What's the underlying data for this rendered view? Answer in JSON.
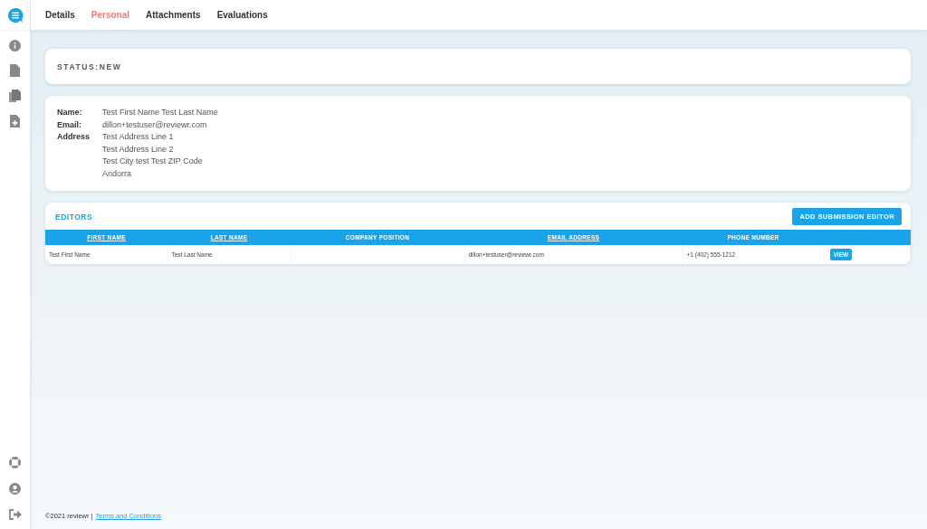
{
  "tabs": [
    {
      "label": "Details",
      "selected": false
    },
    {
      "label": "Personal",
      "selected": true
    },
    {
      "label": "Attachments",
      "selected": false
    },
    {
      "label": "Evaluations",
      "selected": false
    }
  ],
  "status": {
    "text": "STATUS:NEW"
  },
  "person": {
    "fields": [
      {
        "label": "Name:",
        "lines": [
          "Test First Name Test Last Name"
        ]
      },
      {
        "label": "Email:",
        "lines": [
          "dillon+testuser@reviewr.com"
        ]
      },
      {
        "label": "Address",
        "lines": [
          "Test Address Line 1",
          "Test Address Line 2",
          "Test City test Test ZIP Code",
          "Andorra"
        ]
      }
    ]
  },
  "editors": {
    "title": "EDITORS",
    "add_button": "ADD SUBMISSION EDITOR",
    "columns": [
      {
        "label": "FIRST NAME",
        "sortable": true
      },
      {
        "label": "LAST NAME",
        "sortable": true
      },
      {
        "label": "COMPANY POSITION",
        "sortable": false
      },
      {
        "label": "EMAIL ADDRESS",
        "sortable": true
      },
      {
        "label": "PHONE NUMBER",
        "sortable": false
      }
    ],
    "rows": [
      {
        "cells": [
          "Test First Name",
          "Test Last Name",
          "",
          "dillon+testuser@reviewr.com",
          "+1 (402) 555-1212"
        ],
        "action": "VIEW"
      }
    ]
  },
  "footer": {
    "copyright": "©2021 reviewr |",
    "link": "Terms and Conditions"
  }
}
